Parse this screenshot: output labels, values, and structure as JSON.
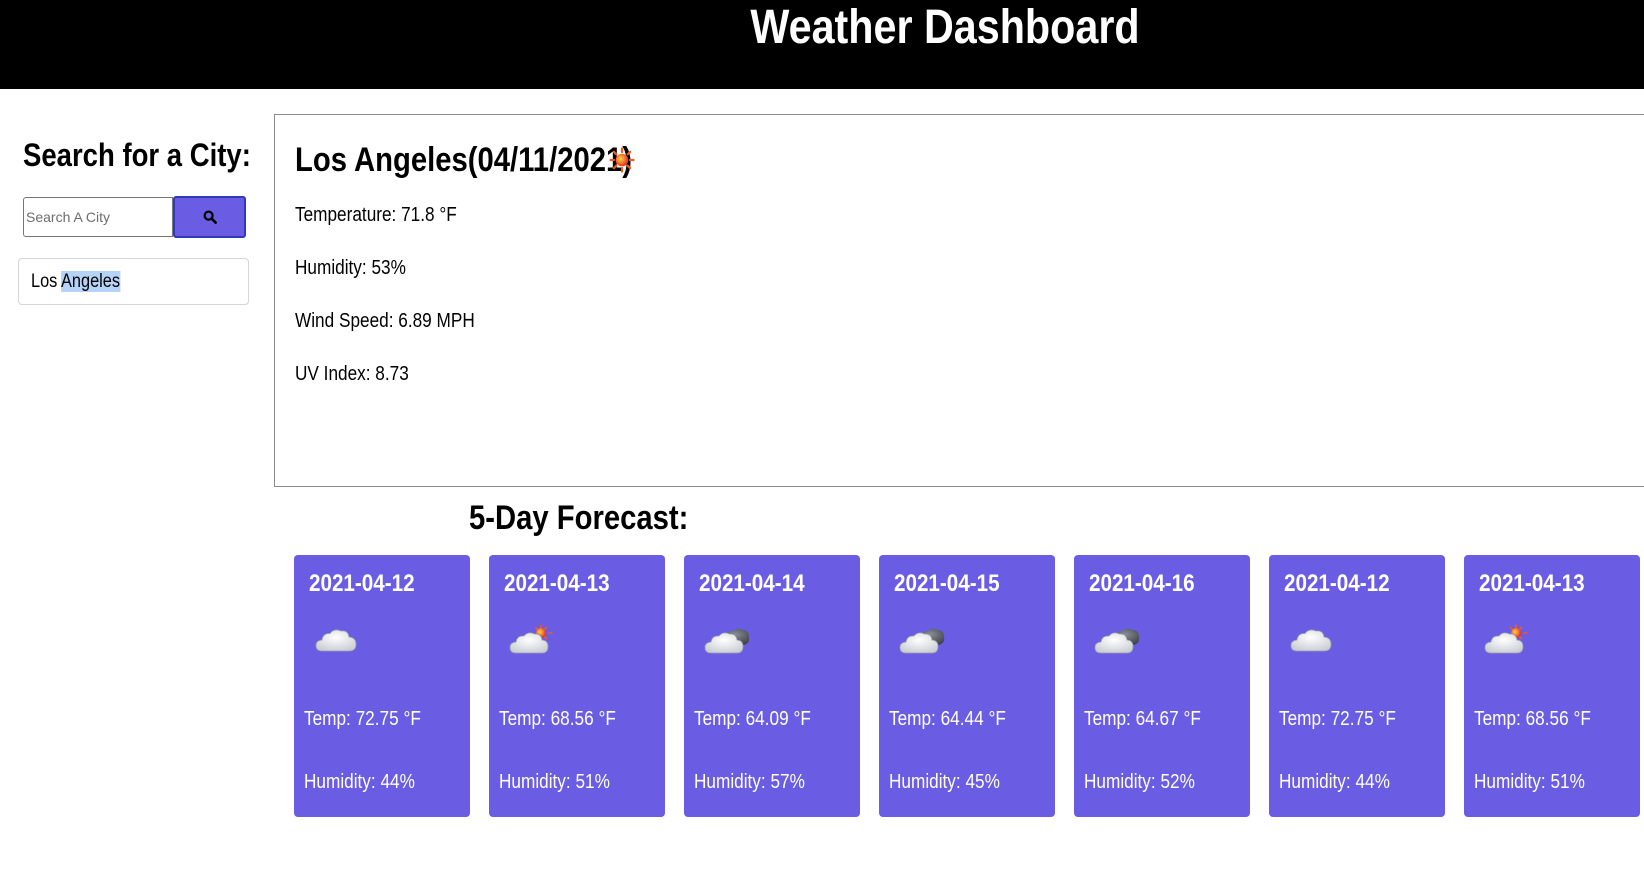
{
  "header": {
    "title": "Weather Dashboard"
  },
  "search": {
    "heading": "Search for a City:",
    "placeholder": "Search A City",
    "button_icon": "search-icon",
    "history": [
      {
        "first": "Los",
        "second": "Angeles"
      }
    ]
  },
  "current": {
    "title": "Los Angeles(04/11/2021)",
    "icon": "sun-icon",
    "temperature": "Temperature: 71.8 °F",
    "humidity": "Humidity: 53%",
    "wind": "Wind Speed: 6.89 MPH",
    "uv": "UV Index: 8.73"
  },
  "forecast": {
    "heading": "5-Day Forecast:",
    "days": [
      {
        "date": "2021-04-12",
        "icon": "cloud-icon",
        "temp": "Temp: 72.75 °F",
        "humidity": "Humidity: 44%"
      },
      {
        "date": "2021-04-13",
        "icon": "sun-behind-cloud-icon",
        "temp": "Temp: 68.56 °F",
        "humidity": "Humidity: 51%"
      },
      {
        "date": "2021-04-14",
        "icon": "broken-clouds-icon",
        "temp": "Temp: 64.09 °F",
        "humidity": "Humidity: 57%"
      },
      {
        "date": "2021-04-15",
        "icon": "broken-clouds-icon",
        "temp": "Temp: 64.44 °F",
        "humidity": "Humidity: 45%"
      },
      {
        "date": "2021-04-16",
        "icon": "broken-clouds-icon",
        "temp": "Temp: 64.67 °F",
        "humidity": "Humidity: 52%"
      },
      {
        "date": "2021-04-12",
        "icon": "cloud-icon",
        "temp": "Temp: 72.75 °F",
        "humidity": "Humidity: 44%"
      },
      {
        "date": "2021-04-13",
        "icon": "sun-behind-cloud-icon",
        "temp": "Temp: 68.56 °F",
        "humidity": "Humidity: 51%"
      }
    ]
  },
  "colors": {
    "header_bg": "#000000",
    "accent": "#6a5de3",
    "button_border": "#2e3ab8",
    "highlight": "#b5d3f7"
  }
}
